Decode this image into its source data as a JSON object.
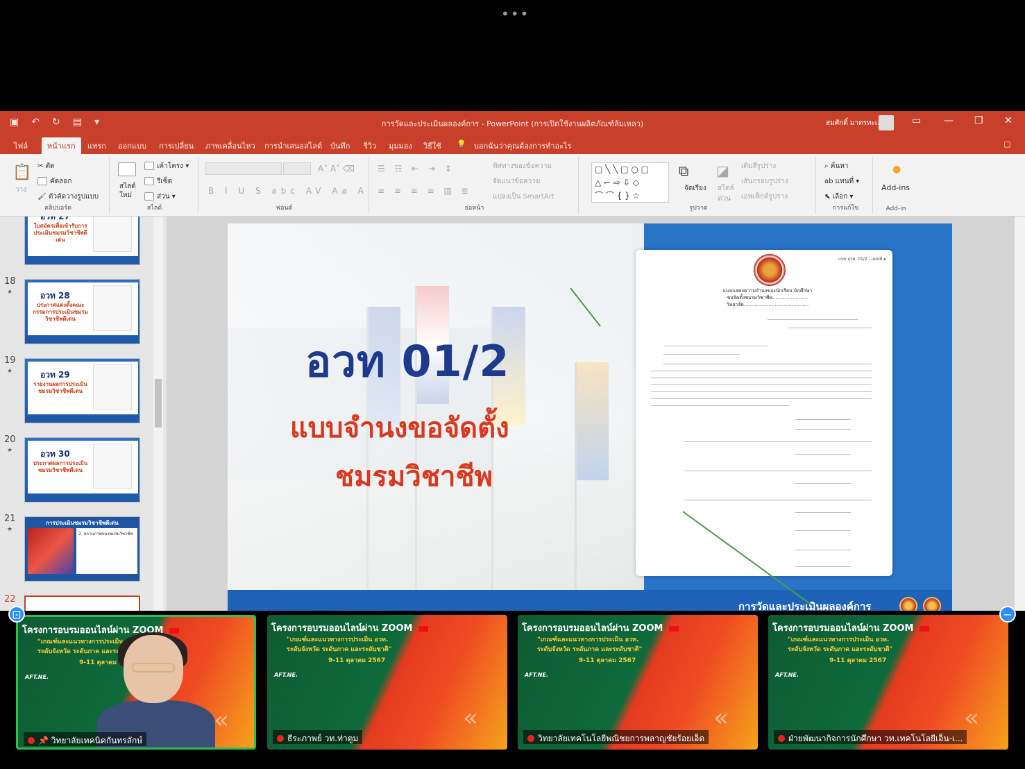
{
  "window": {
    "title": "การวัดและประเมินผลองค์การ - PowerPoint (การเปิดใช้งานผลิตภัณฑ์ล้มเหลว)",
    "user": "สมศักดิ์ มาตรทะเล"
  },
  "tabs": [
    "ไฟล์",
    "หน้าแรก",
    "แทรก",
    "ออกแบบ",
    "การเปลี่ยน",
    "ภาพเคลื่อนไหว",
    "การนำเสนอสไลด์",
    "บันทึก",
    "รีวิว",
    "มุมมอง",
    "วิธีใช้"
  ],
  "tell_me": "บอกฉันว่าคุณต้องการทำอะไร",
  "ribbon": {
    "clipboard": {
      "label": "คลิปบอร์ด",
      "paste": "วาง",
      "cut": "ตัด",
      "copy": "คัดลอก",
      "format_painter": "ตัวคัดวางรูปแบบ"
    },
    "slides": {
      "label": "สไลด์",
      "new_slide": "สไลด์ใหม่",
      "layout": "เค้าโครง",
      "reset": "รีเซ็ต",
      "section": "ส่วน"
    },
    "font": {
      "label": "ฟอนต์"
    },
    "paragraph": {
      "label": "ย่อหน้า",
      "text_direction": "ทิศทางของข้อความ",
      "align_text": "จัดแนวข้อความ",
      "smartart": "แปลงเป็น SmartArt"
    },
    "drawing": {
      "label": "รูปวาด",
      "arrange": "จัดเรียง",
      "quick_styles": "สไตล์ด่วน",
      "fill": "เติมสีรูปร่าง",
      "outline": "เส้นกรอบรูปร่าง",
      "effects": "เอฟเฟ็กต์รูปร่าง"
    },
    "editing": {
      "label": "การแก้ไข",
      "find": "ค้นหา",
      "replace": "แทนที่",
      "select": "เลือก"
    },
    "addins": {
      "label": "Add-in",
      "button": "Add-ins"
    }
  },
  "thumbnails": [
    {
      "num": "",
      "code": "อวท 27",
      "caption": "ใบสมัครเพื่อเข้ารับการประเมินชมรมวิชาชีพดีเด่น"
    },
    {
      "num": "18",
      "code": "อวท 28",
      "caption": "ประกาศแต่งตั้งคณะกรรมการประเมินชมรมวิชาชีพดีเด่น"
    },
    {
      "num": "19",
      "code": "อวท 29",
      "caption": "รายงานผลการประเมินชมรมวิชาชีพดีเด่น"
    },
    {
      "num": "20",
      "code": "อวท 30",
      "caption": "ประกาศผลการประเมินชมรมวิชาชีพดีเด่น"
    },
    {
      "num": "21",
      "header": "การประเมินชมรมวิชาชีพดีเด่น",
      "caption": "2. สถานภาพของชมรมวิชาชีพ"
    },
    {
      "num": "22"
    }
  ],
  "slide": {
    "code": "อวท 01/2",
    "title_line1": "แบบจำนงขอจัดตั้ง",
    "title_line2": "ชมรมวิชาชีพ",
    "footer": "การวัดและประเมินผลองค์การ",
    "form_header": [
      "แบบแสดงความจำนงของนักเรียน นักศึกษา",
      "ขอจัดตั้งชมรมวิชาชีพ.......................",
      "วิทยาลัย.........................................."
    ],
    "form_ref": "แบบ อวท. 01/2 - แผ่นที่ ๑"
  },
  "zoom": {
    "tiles": [
      {
        "title": "โครงการอบรมออนไลน์ผ่าน ZOOM",
        "sub1": "\"เกณฑ์และแนวทางการประเมิน อวท.",
        "sub2": "ระดับจังหวัด ระดับภาค และระดับชาติ\"",
        "sub3": "9-11 ตุลาคม 2567",
        "brand": "AFT.NE.",
        "name": "วิทยาลัยเทคนิคกันทรลักษ์"
      },
      {
        "title": "โครงการอบรมออนไลน์ผ่าน ZOOM",
        "sub1": "\"เกณฑ์และแนวทางการประเมิน อวท.",
        "sub2": "ระดับจังหวัด ระดับภาค และระดับชาติ\"",
        "sub3": "9-11 ตุลาคม 2567",
        "brand": "AFT.NE.",
        "name": "ธีระภาพย์ วท.ท่าตูม"
      },
      {
        "title": "โครงการอบรมออนไลน์ผ่าน ZOOM",
        "sub1": "\"เกณฑ์และแนวทางการประเมิน อวท.",
        "sub2": "ระดับจังหวัด ระดับภาค และระดับชาติ\"",
        "sub3": "9-11 ตุลาคม 2567",
        "brand": "AFT.NE.",
        "name": "วิทยาลัยเทคโนโลยีพณิชยการพลาญชัยร้อยเอ็ด"
      },
      {
        "title": "โครงการอบรมออนไลน์ผ่าน ZOOM",
        "sub1": "\"เกณฑ์และแนวทางการประเมิน อวท.",
        "sub2": "ระดับจังหวัด ระดับภาค และระดับชาติ\"",
        "sub3": "9-11 ตุลาคม 2567",
        "brand": "AFT.NE.",
        "name": "ฝ่ายพัฒนากิจการนักศึกษา วท.เทคโนโลยีเอ็น-เ..."
      }
    ]
  },
  "colors": {
    "accent": "#c8402a",
    "slide_blue": "#1e63b8",
    "active_speaker": "#2fbf52"
  }
}
